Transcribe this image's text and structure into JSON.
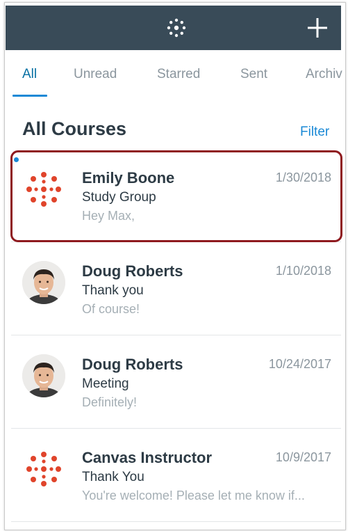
{
  "navbar": {
    "logo_icon": "canvas-logo-icon",
    "compose_icon": "plus-icon"
  },
  "tabs": [
    {
      "label": "All",
      "active": true
    },
    {
      "label": "Unread",
      "active": false
    },
    {
      "label": "Starred",
      "active": false
    },
    {
      "label": "Sent",
      "active": false
    },
    {
      "label": "Archiv",
      "active": false
    }
  ],
  "section": {
    "title": "All Courses",
    "filter_label": "Filter"
  },
  "conversations": [
    {
      "name": "Emily Boone",
      "subject": "Study Group",
      "preview": "Hey Max,",
      "date": "1/30/2018",
      "unread": true,
      "avatar": "canvas-logo-icon"
    },
    {
      "name": "Doug Roberts",
      "subject": "Thank you",
      "preview": "Of course!",
      "date": "1/10/2018",
      "unread": false,
      "avatar": "user-photo"
    },
    {
      "name": "Doug Roberts",
      "subject": "Meeting",
      "preview": "Definitely!",
      "date": "10/24/2017",
      "unread": false,
      "avatar": "user-photo"
    },
    {
      "name": "Canvas Instructor",
      "subject": "Thank You",
      "preview": "You're welcome! Please let me know if...",
      "date": "10/9/2017",
      "unread": false,
      "avatar": "canvas-logo-icon"
    }
  ],
  "colors": {
    "navbar": "#394b58",
    "accent": "#1a89d6",
    "canvas_red": "#e0442b",
    "highlight": "#8f1a1f"
  }
}
